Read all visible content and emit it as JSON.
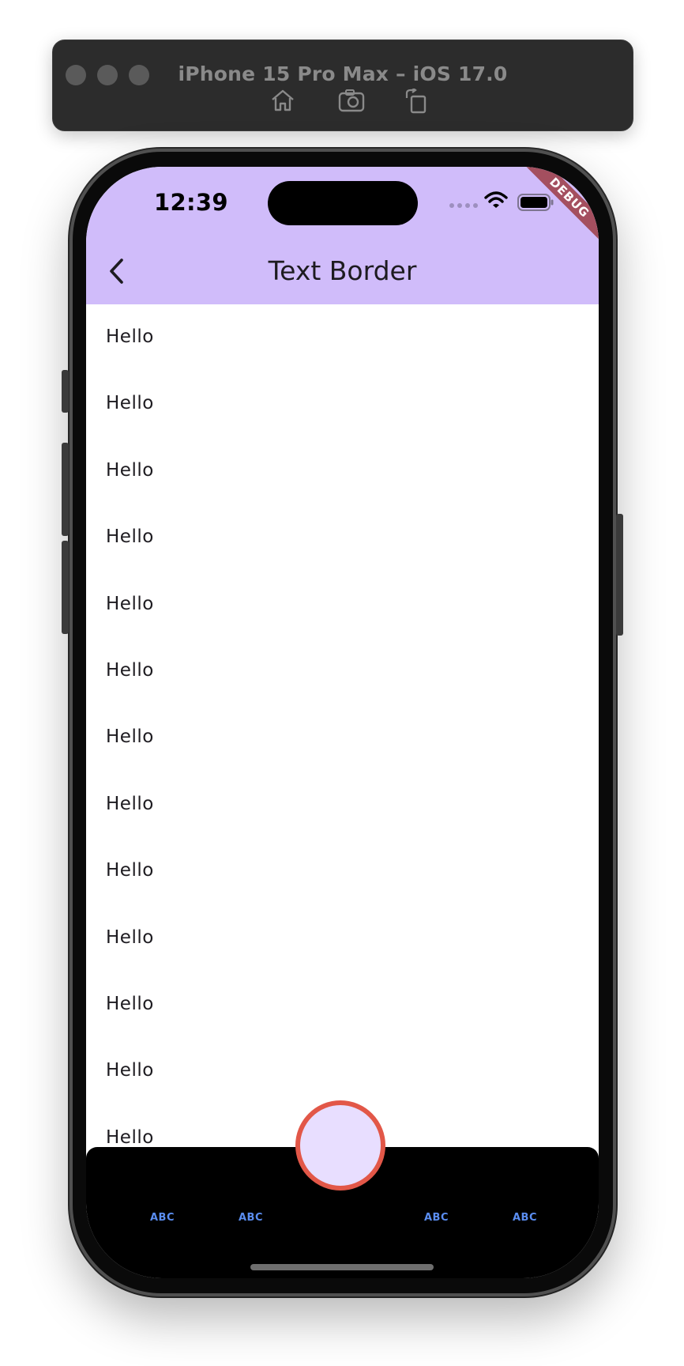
{
  "simulator": {
    "title": "iPhone 15 Pro Max – iOS 17.0",
    "controls": [
      "home-icon",
      "screenshot-icon",
      "rotate-icon"
    ]
  },
  "status_bar": {
    "time": "12:39",
    "debug_label": "DEBUG"
  },
  "appbar": {
    "title": "Text Border",
    "background": "#d0bcfa"
  },
  "list": {
    "items": [
      "Hello",
      "Hello",
      "Hello",
      "Hello",
      "Hello",
      "Hello",
      "Hello",
      "Hello",
      "Hello",
      "Hello",
      "Hello",
      "Hello",
      "Hello"
    ]
  },
  "bottom_nav": {
    "tabs": [
      "ABC",
      "ABC",
      "ABC",
      "ABC"
    ],
    "tab_color": "#5a8df0"
  },
  "fab": {
    "fill": "#e8deff",
    "border": "#e25748"
  }
}
